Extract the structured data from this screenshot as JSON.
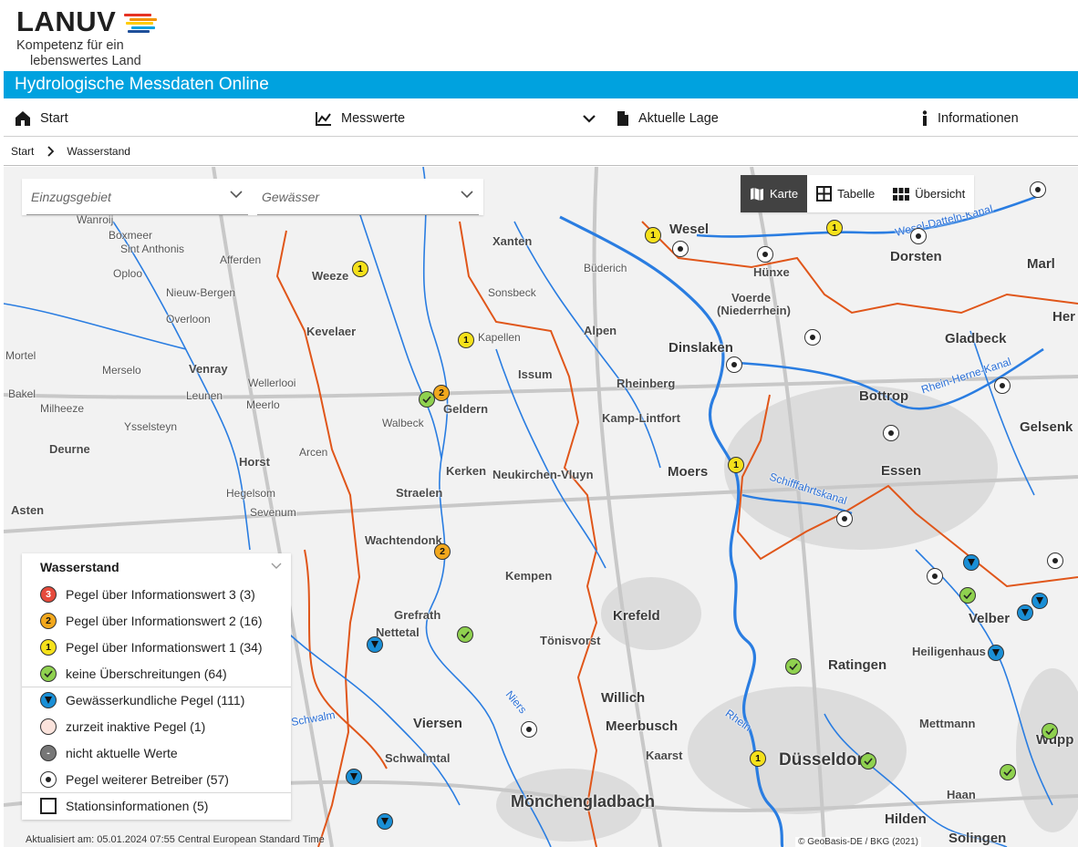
{
  "logo": {
    "word": "LANUV",
    "tagline_1": "Kompetenz für ein",
    "tagline_2": "lebenswertes Land",
    "stripe_colors": [
      "#e63323",
      "#f39200",
      "#ffcc00",
      "#00a2df",
      "#1d4f9a"
    ]
  },
  "app": {
    "title": "Hydrologische Messdaten Online"
  },
  "nav": {
    "start": "Start",
    "messwerte": "Messwerte",
    "aktuelle_lage": "Aktuelle Lage",
    "informationen": "Informationen"
  },
  "breadcrumb": {
    "home": "Start",
    "current": "Wasserstand"
  },
  "filters": {
    "einzugsgebiet": "Einzugsgebiet",
    "gewaesser": "Gewässer"
  },
  "views": {
    "karte": "Karte",
    "tabelle": "Tabelle",
    "uebersicht": "Übersicht"
  },
  "legend": {
    "title": "Wasserstand",
    "items": [
      {
        "symbol": "3",
        "label": "Pegel über Informationswert 3 (3)"
      },
      {
        "symbol": "2",
        "label": "Pegel über Informationswert 2 (16)"
      },
      {
        "symbol": "1",
        "label": "Pegel über Informationswert 1 (34)"
      },
      {
        "symbol": "check",
        "label": "keine Überschreitungen (64)"
      },
      {
        "symbol": "triangle",
        "label": "Gewässerkundliche Pegel (111)"
      },
      {
        "symbol": "",
        "label": "zurzeit inaktive Pegel (1)"
      },
      {
        "symbol": "-",
        "label": "nicht aktuelle Werte"
      },
      {
        "symbol": "dot",
        "label": "Pegel weiterer Betreiber (57)"
      },
      {
        "symbol": "checkbox",
        "label": "Stationsinformationen (5)"
      }
    ]
  },
  "colors": {
    "accent": "#00a2df",
    "level_3": "#e64b3c",
    "level_2": "#f2a81d",
    "level_1": "#f5e11b",
    "ok": "#8fd14f",
    "gauge": "#1a8fd6",
    "river": "#2a7de1",
    "boundary": "#e0561a"
  },
  "map": {
    "places": {
      "wesel": "Wesel",
      "xanten": "Xanten",
      "dorsten": "Dorsten",
      "marl": "Marl",
      "huenxe": "Hünxe",
      "voerde": "Voerde",
      "niederrhein": "(Niederrhein)",
      "dinslaken": "Dinslaken",
      "gladbeck": "Gladbeck",
      "bottrop": "Bottrop",
      "gelsenk": "Gelsenk",
      "essen": "Essen",
      "moers": "Moers",
      "krefeld": "Krefeld",
      "ratingen": "Ratingen",
      "duesseldorf": "Düsseldorf",
      "moenchengladbach": "Mönchengladbach",
      "viersen": "Viersen",
      "willich": "Willich",
      "meerbusch": "Meerbusch",
      "kaarst": "Kaarst",
      "kempen": "Kempen",
      "toenisvorst": "Tönisvorst",
      "nettetal": "Nettetal",
      "grefrath": "Grefrath",
      "straelen": "Straelen",
      "geldern": "Geldern",
      "kerken": "Kerken",
      "neukirchen": "Neukirchen-Vluyn",
      "kamp": "Kamp-Lintfort",
      "rheinberg": "Rheinberg",
      "issum": "Issum",
      "alpen": "Alpen",
      "sonsbeck": "Sonsbeck",
      "kevelaer": "Kevelaer",
      "weeze": "Weeze",
      "venray": "Venray",
      "horst": "Horst",
      "deurne": "Deurne",
      "asten": "Asten",
      "boxmeer": "Boxmeer",
      "velbert": "Velber",
      "heiligenhaus": "Heiligenhaus",
      "mettmann": "Mettmann",
      "hilden": "Hilden",
      "wuppertal": "Wupp",
      "haan": "Haan",
      "solingen": "Solingen",
      "schwalmtal": "Schwalmtal",
      "wachtendonk": "Wachtendonk",
      "kapellen": "Kapellen",
      "meerlo": "Meerlo",
      "leunen": "Leunen",
      "merselo": "Merselo",
      "overloon": "Overloon",
      "wanroij": "Wanroij",
      "sevenum": "Sevenum",
      "hegelsom": "Hegelsom",
      "mortel": "Mortel",
      "bakel": "Bakel",
      "milheeze": "Milheeze",
      "ysselsteyn": "Ysselsteyn",
      "arcen": "Arcen",
      "walbeck": "Walbeck",
      "oploo": "Oploo",
      "sint_anthonis": "Sint Anthonis",
      "nieuw_bergen": "Nieuw-Bergen",
      "wellerlooi": "Wellerlooi",
      "afferden": "Afferden",
      "budberg": "Büderich",
      "her": "Her",
      "rhein_label": "Rhein",
      "niers_label": "Niers",
      "wdk_label": "Wesel-Datteln-Kanal",
      "rhk_label": "Rhein-Herne-Kanal",
      "schiff_label": "Schifffahrtskanal",
      "schwalm_label": "Schwalm"
    }
  },
  "footer": {
    "updated": "Aktualisiert am: 05.01.2024 07:55 Central European Standard Time",
    "copyright": "© GeoBasis-DE / BKG (2021)"
  }
}
